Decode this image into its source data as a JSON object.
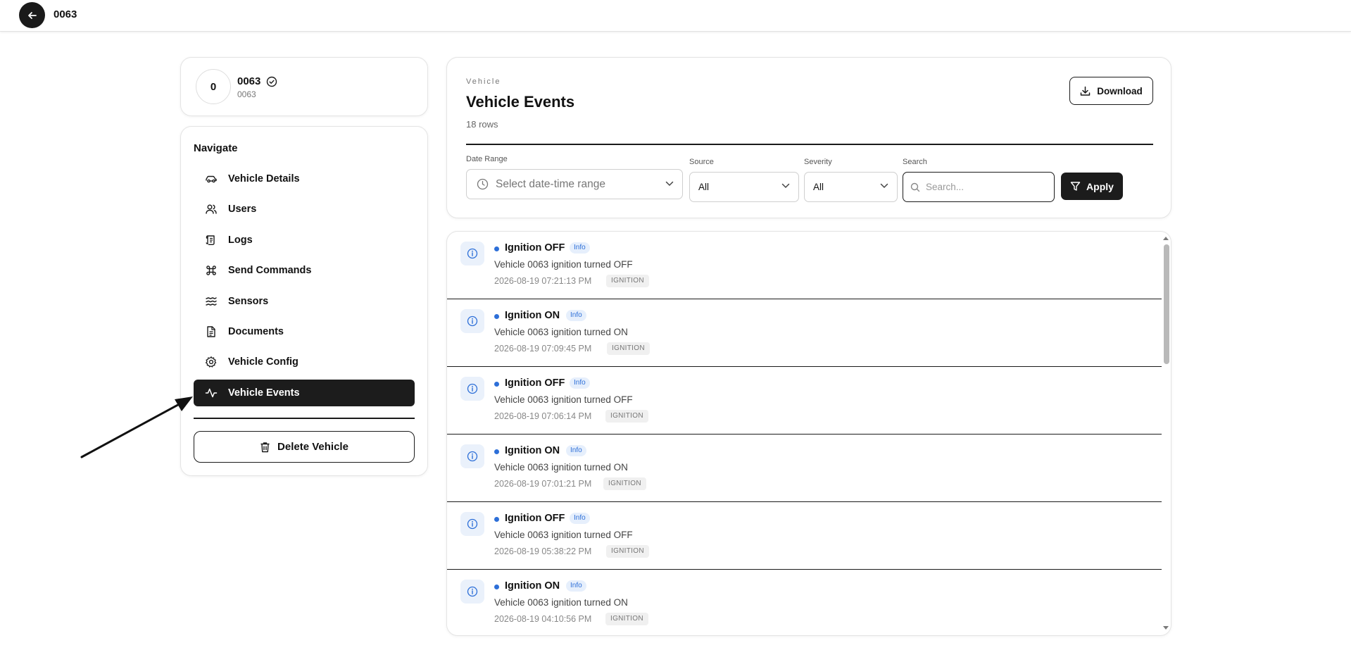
{
  "topbar": {
    "title": "0063",
    "back_icon": "arrow-left-icon"
  },
  "vehicle": {
    "avatar_initial": "0",
    "name": "0063",
    "subtitle": "0063",
    "verified_icon": "check-circle-icon"
  },
  "nav": {
    "heading": "Navigate",
    "items": [
      {
        "label": "Vehicle Details",
        "icon": "car-icon",
        "active": false
      },
      {
        "label": "Users",
        "icon": "users-icon",
        "active": false
      },
      {
        "label": "Logs",
        "icon": "scroll-icon",
        "active": false
      },
      {
        "label": "Send Commands",
        "icon": "command-icon",
        "active": false
      },
      {
        "label": "Sensors",
        "icon": "waves-icon",
        "active": false
      },
      {
        "label": "Documents",
        "icon": "file-icon",
        "active": false
      },
      {
        "label": "Vehicle Config",
        "icon": "gear-icon",
        "active": false
      },
      {
        "label": "Vehicle Events",
        "icon": "activity-icon",
        "active": true
      }
    ],
    "delete_label": "Delete Vehicle"
  },
  "header": {
    "eyebrow": "Vehicle",
    "title": "Vehicle Events",
    "row_count": "18 rows",
    "download_label": "Download"
  },
  "filters": {
    "date_label": "Date Range",
    "date_placeholder": "Select date-time range",
    "source_label": "Source",
    "source_value": "All",
    "severity_label": "Severity",
    "severity_value": "All",
    "search_label": "Search",
    "search_placeholder": "Search...",
    "apply_label": "Apply"
  },
  "events": [
    {
      "title": "Ignition OFF",
      "severity": "Info",
      "description": "Vehicle 0063 ignition turned OFF",
      "time": "2026-08-19 07:21:13 PM",
      "tag": "IGNITION"
    },
    {
      "title": "Ignition ON",
      "severity": "Info",
      "description": "Vehicle 0063 ignition turned ON",
      "time": "2026-08-19 07:09:45 PM",
      "tag": "IGNITION"
    },
    {
      "title": "Ignition OFF",
      "severity": "Info",
      "description": "Vehicle 0063 ignition turned OFF",
      "time": "2026-08-19 07:06:14 PM",
      "tag": "IGNITION"
    },
    {
      "title": "Ignition ON",
      "severity": "Info",
      "description": "Vehicle 0063 ignition turned ON",
      "time": "2026-08-19 07:01:21 PM",
      "tag": "IGNITION"
    },
    {
      "title": "Ignition OFF",
      "severity": "Info",
      "description": "Vehicle 0063 ignition turned OFF",
      "time": "2026-08-19 05:38:22 PM",
      "tag": "IGNITION"
    },
    {
      "title": "Ignition ON",
      "severity": "Info",
      "description": "Vehicle 0063 ignition turned ON",
      "time": "2026-08-19 04:10:56 PM",
      "tag": "IGNITION"
    }
  ],
  "colors": {
    "accent_dark": "#1c1c1c",
    "info_blue": "#2d6fd8",
    "info_bg": "#eaf1fb"
  }
}
